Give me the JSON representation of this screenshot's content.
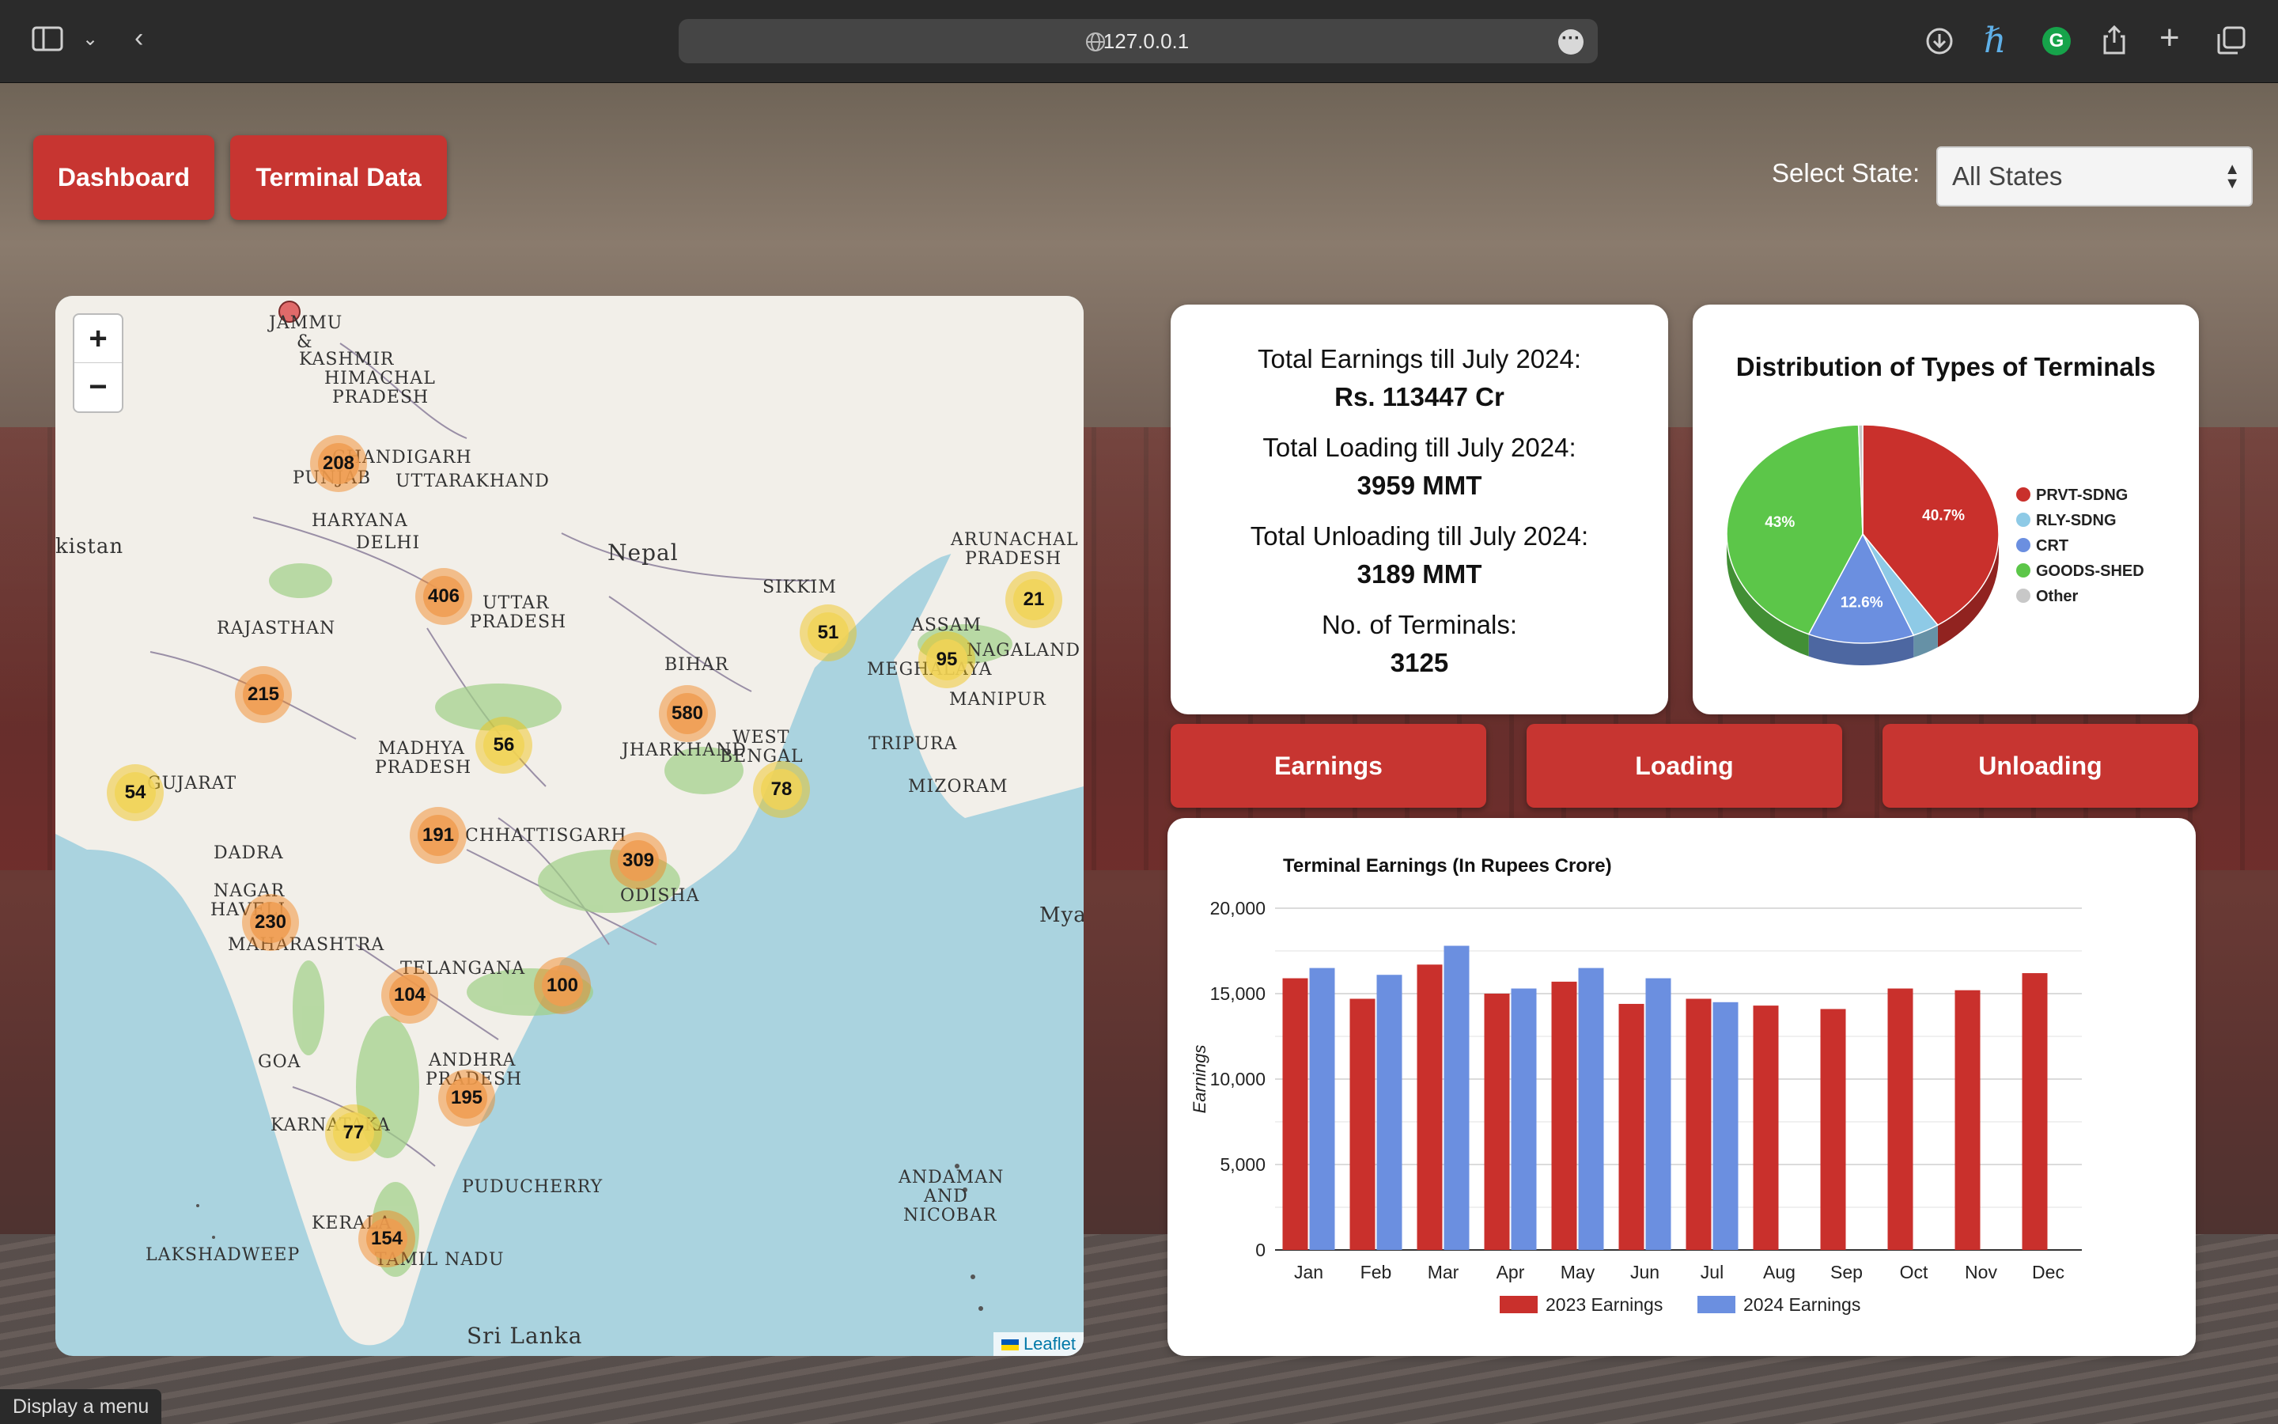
{
  "browser": {
    "url": "127.0.0.1",
    "icons": [
      "sidebar-icon",
      "chevron-down-icon",
      "back-icon",
      "globe-icon",
      "more-icon",
      "download-icon",
      "extension-h-icon",
      "grammarly-icon",
      "share-icon",
      "new-tab-icon",
      "tabs-icon"
    ]
  },
  "nav": {
    "dashboard": "Dashboard",
    "terminal_data": "Terminal Data"
  },
  "state_filter": {
    "label": "Select State:",
    "selected": "All States"
  },
  "map": {
    "labels": [
      "JAMMU",
      "&",
      "KASHMIR",
      "HIMACHAL",
      "PRADESH",
      "CHANDIGARH",
      "PUNJAB",
      "UTTARAKHAND",
      "HARYANA",
      "DELHI",
      "Nepal",
      "ARUNACHAL",
      "PRADESH",
      "SIKKIM",
      "ASSAM",
      "NAGALAND",
      "MEGHALAYA",
      "MANIPUR",
      "RAJASTHAN",
      "UTTAR",
      "PRADESH",
      "BIHAR",
      "JHARKHAND",
      "WEST",
      "BENGAL",
      "TRIPURA",
      "MIZORAM",
      "GUJARAT",
      "MADHYA",
      "PRADESH",
      "CHHATTISGARH",
      "DADRA",
      "NAGAR",
      "HAVELI",
      "MAHARASHTRA",
      "ODISHA",
      "Mya",
      "TELANGANA",
      "GOA",
      "ANDHRA",
      "PRADESH",
      "KARNATAKA",
      "PUDUCHERRY",
      "ANDAMAN",
      "AND",
      "NICOBAR",
      "KERALA",
      "TAMIL NADU",
      "LAKSHADWEEP",
      "Sri Lanka",
      "kistan"
    ],
    "clusters": [
      208,
      406,
      215,
      54,
      56,
      191,
      230,
      104,
      77,
      154,
      195,
      100,
      309,
      580,
      78,
      51,
      95,
      21
    ],
    "zoom_in": "+",
    "zoom_out": "−",
    "attribution": "Leaflet"
  },
  "stats": {
    "earnings_label": "Total Earnings till July 2024:",
    "earnings_value": "Rs. 113447 Cr",
    "loading_label": "Total Loading till July 2024:",
    "loading_value": "3959 MMT",
    "unloading_label": "Total Unloading till July 2024:",
    "unloading_value": "3189 MMT",
    "terminals_label": "No. of Terminals:",
    "terminals_value": "3125"
  },
  "tabs": {
    "earnings": "Earnings",
    "loading": "Loading",
    "unloading": "Unloading"
  },
  "chart_data": [
    {
      "type": "pie",
      "title": "Distribution of Types of Terminals",
      "categories": [
        "PRVT-SDNG",
        "RLY-SDNG",
        "CRT",
        "GOODS-SHED",
        "Other"
      ],
      "values": [
        40.7,
        3.2,
        12.6,
        43.0,
        0.5
      ],
      "slice_labels": [
        "40.7%",
        "",
        "12.6%",
        "43%",
        ""
      ],
      "colors": [
        "#c9302c",
        "#8ecae6",
        "#6b8fe0",
        "#5cc649",
        "#c8c8c8"
      ],
      "legend_position": "right",
      "style": "3d"
    },
    {
      "type": "bar",
      "title": "Terminal Earnings (In Rupees Crore)",
      "ylabel": "Earnings",
      "xlabel": "",
      "categories": [
        "Jan",
        "Feb",
        "Mar",
        "Apr",
        "May",
        "Jun",
        "Jul",
        "Aug",
        "Sep",
        "Oct",
        "Nov",
        "Dec"
      ],
      "series": [
        {
          "name": "2023 Earnings",
          "color": "#c9302c",
          "values": [
            15900,
            14700,
            16700,
            15000,
            15700,
            14400,
            14700,
            14300,
            14100,
            15300,
            15200,
            16200
          ]
        },
        {
          "name": "2024 Earnings",
          "color": "#6b8fe0",
          "values": [
            16500,
            16100,
            17800,
            15300,
            16500,
            15900,
            14500,
            null,
            null,
            null,
            null,
            null
          ]
        }
      ],
      "ylim": [
        0,
        20000
      ],
      "yticks": [
        "0",
        "5,000",
        "10,000",
        "15,000",
        "20,000"
      ],
      "legend_position": "bottom",
      "grid": true
    }
  ],
  "status_bar": "Display a menu"
}
